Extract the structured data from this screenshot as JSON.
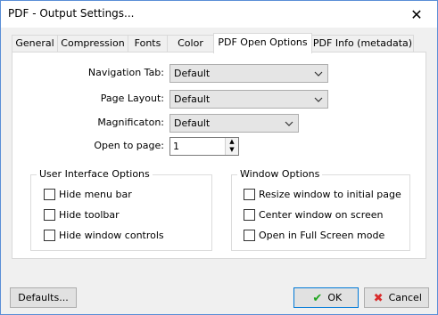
{
  "window": {
    "title": "PDF - Output Settings...",
    "close_icon": "close-icon"
  },
  "tabs": [
    {
      "label": "General"
    },
    {
      "label": "Compression"
    },
    {
      "label": "Fonts"
    },
    {
      "label": "Color"
    },
    {
      "label": "PDF Open Options",
      "active": true
    },
    {
      "label": "PDF Info (metadata)"
    }
  ],
  "form": {
    "navigation_tab": {
      "label": "Navigation Tab:",
      "value": "Default"
    },
    "page_layout": {
      "label": "Page Layout:",
      "value": "Default"
    },
    "magnification": {
      "label": "Magnificaton:",
      "value": "Default"
    },
    "open_to_page": {
      "label": "Open to page:",
      "value": "1"
    }
  },
  "ui_options": {
    "title": "User Interface Options",
    "items": [
      {
        "label": "Hide menu bar",
        "checked": false
      },
      {
        "label": "Hide toolbar",
        "checked": false
      },
      {
        "label": "Hide window controls",
        "checked": false
      }
    ]
  },
  "window_options": {
    "title": "Window Options",
    "items": [
      {
        "label": "Resize window to initial page",
        "checked": false
      },
      {
        "label": "Center window on screen",
        "checked": false
      },
      {
        "label": "Open in Full Screen mode",
        "checked": false
      }
    ]
  },
  "buttons": {
    "defaults": "Defaults...",
    "ok": "OK",
    "cancel": "Cancel"
  },
  "colors": {
    "ok_icon": "#21a621",
    "cancel_icon": "#d92b2b",
    "accent_border": "#0078d7"
  }
}
